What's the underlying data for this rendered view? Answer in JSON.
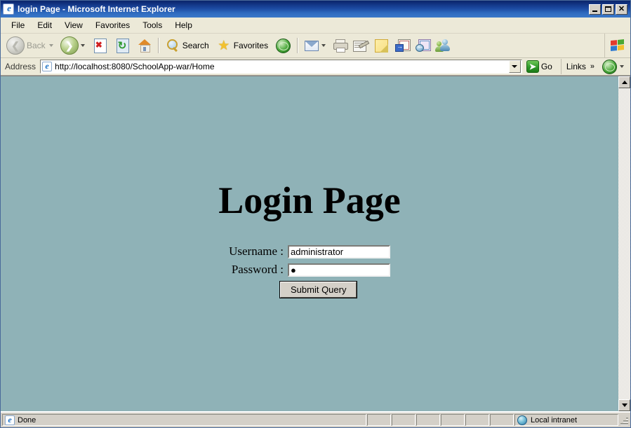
{
  "window": {
    "title": "login Page - Microsoft Internet Explorer",
    "icon": "ie-document-icon",
    "buttons": {
      "minimize": "_",
      "maximize": "□",
      "close": "✕"
    }
  },
  "menubar": {
    "items": [
      {
        "label": "File"
      },
      {
        "label": "Edit"
      },
      {
        "label": "View"
      },
      {
        "label": "Favorites"
      },
      {
        "label": "Tools"
      },
      {
        "label": "Help"
      }
    ]
  },
  "toolbar": {
    "back_label": "Back",
    "back_enabled": false,
    "forward_label": "",
    "search_label": "Search",
    "favorites_label": "Favorites",
    "items": [
      {
        "name": "back-button",
        "label": "Back",
        "icon": "back-arrow-icon"
      },
      {
        "name": "forward-button",
        "label": "",
        "icon": "forward-arrow-icon"
      },
      {
        "name": "stop-button",
        "label": "",
        "icon": "stop-icon"
      },
      {
        "name": "refresh-button",
        "label": "",
        "icon": "refresh-icon"
      },
      {
        "name": "home-button",
        "label": "",
        "icon": "home-icon"
      },
      {
        "name": "search-button",
        "label": "Search",
        "icon": "search-icon"
      },
      {
        "name": "favorites-button",
        "label": "Favorites",
        "icon": "star-icon"
      },
      {
        "name": "media-button",
        "label": "",
        "icon": "media-globe-icon"
      },
      {
        "name": "mail-button",
        "label": "",
        "icon": "mail-icon"
      },
      {
        "name": "print-button",
        "label": "",
        "icon": "printer-icon"
      },
      {
        "name": "edit-button",
        "label": "",
        "icon": "edit-page-icon"
      },
      {
        "name": "notes-button",
        "label": "",
        "icon": "sticky-note-icon"
      },
      {
        "name": "research-button",
        "label": "",
        "icon": "research-icon"
      },
      {
        "name": "discuss-button",
        "label": "",
        "icon": "discuss-icon"
      },
      {
        "name": "messenger-button",
        "label": "",
        "icon": "messenger-people-icon"
      }
    ],
    "brand_icon": "windows-flag-logo"
  },
  "address": {
    "label": "Address",
    "url": "http://localhost:8080/SchoolApp-war/Home",
    "placeholder": "",
    "site_icon": "ie-page-icon",
    "go_label": "Go",
    "go_icon": "green-go-arrow-icon",
    "links_label": "Links",
    "links_chevron": "»",
    "dropdown_icon": "chevron-down-icon",
    "tray_icon": "globe-page-icon"
  },
  "page": {
    "background_color": "#8fb2b7",
    "heading": "Login Page",
    "fields": [
      {
        "name": "username",
        "label": "Username :",
        "value": "administrator",
        "placeholder": "",
        "type": "text"
      },
      {
        "name": "password",
        "label": "Password :",
        "value": "●",
        "placeholder": "",
        "type": "password"
      }
    ],
    "submit_label": "Submit Query"
  },
  "scrollbar": {
    "up_icon": "scroll-up-arrow-icon",
    "down_icon": "scroll-down-arrow-icon"
  },
  "statusbar": {
    "status_text": "Done",
    "status_icon": "ie-page-icon",
    "zone_text": "Local intranet",
    "zone_icon": "local-intranet-globe-icon",
    "segments": [
      "",
      "",
      "",
      "",
      "",
      ""
    ]
  },
  "colors": {
    "titlebar_start": "#0a246a",
    "titlebar_end": "#3a78c8",
    "chrome": "#ece9d8",
    "page_bg": "#8fb2b7",
    "status_bg": "#d4d0c8"
  }
}
